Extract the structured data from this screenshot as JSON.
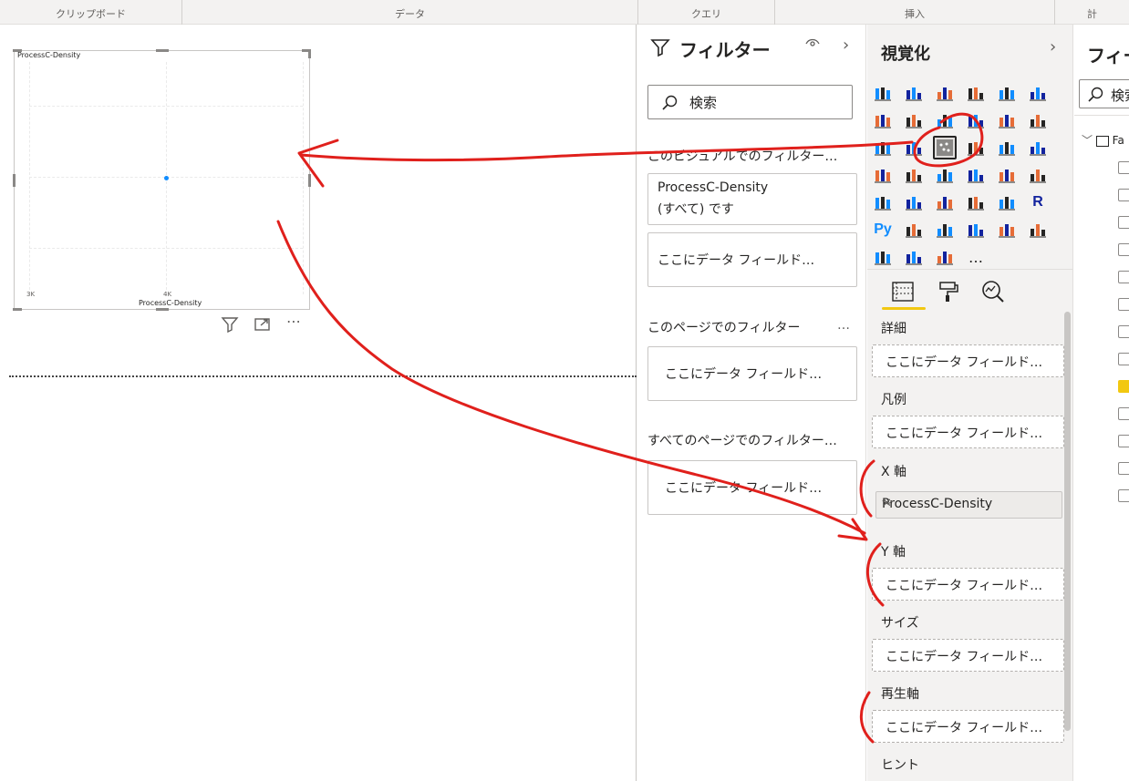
{
  "ribbon": {
    "groups": [
      "クリップボード",
      "データ",
      "クエリ",
      "挿入",
      "計"
    ]
  },
  "visual": {
    "title": "ProcessC-Density",
    "chart_data": {
      "type": "scatter",
      "title": "ProcessC-Density",
      "xlabel": "ProcessC-Density",
      "ylabel": "",
      "x_ticks": [
        "3K",
        "4K"
      ],
      "points": [
        {
          "x": 4000,
          "y": 0.5
        }
      ],
      "grid": true
    }
  },
  "filters": {
    "title": "フィルター",
    "search_placeholder": "検索",
    "this_visual_label": "このビジュアルでのフィルター…",
    "card1_line1": "ProcessC-Density",
    "card1_line2": "(すべて) です",
    "drop_placeholder": "ここにデータ フィールド…",
    "this_page_label": "このページでのフィルター",
    "this_page_more": "…",
    "all_pages_label": "すべてのページでのフィルター…"
  },
  "viz": {
    "title": "視覚化",
    "more": "…",
    "wells": [
      {
        "label": "詳細",
        "value": "ここにデータ フィールド…"
      },
      {
        "label": "凡例",
        "value": "ここにデータ フィールド…"
      },
      {
        "label": "X 軸",
        "value": "ProcessC-Density"
      },
      {
        "label": "Y 軸",
        "value": "ここにデータ フィールド…"
      },
      {
        "label": "サイズ",
        "value": "ここにデータ フィールド…"
      },
      {
        "label": "再生軸",
        "value": "ここにデータ フィールド…"
      },
      {
        "label": "ヒント",
        "value": ""
      }
    ]
  },
  "fields": {
    "title": "フィールド",
    "search_placeholder": "検索",
    "table_name": "Fa"
  },
  "colors": {
    "accent": "#f2c811",
    "data_point": "#118dff",
    "annotation": "#e0201c"
  }
}
